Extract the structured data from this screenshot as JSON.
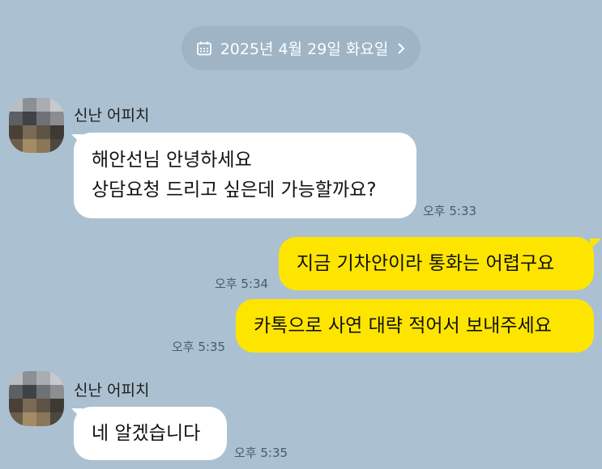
{
  "date_divider": {
    "label": "2025년 4월 29일 화요일",
    "icon": "calendar-icon",
    "chevron": "chevron-right-icon"
  },
  "colors": {
    "background": "#abc1d1",
    "incoming_bubble": "#ffffff",
    "outgoing_bubble": "#fee500",
    "date_pill": "#9fb5c6"
  },
  "messages": [
    {
      "sender": "신난 어피치",
      "lines": [
        "해안선님 안녕하세요",
        "상담요청 드리고 싶은데 가능할까요?"
      ],
      "time": "오후 5:33",
      "direction": "incoming"
    },
    {
      "lines": [
        "지금 기차안이라 통화는 어렵구요"
      ],
      "time": "오후 5:34",
      "direction": "outgoing"
    },
    {
      "lines": [
        "카톡으로 사연 대략 적어서 보내주세요"
      ],
      "time": "오후 5:35",
      "direction": "outgoing"
    },
    {
      "sender": "신난 어피치",
      "lines": [
        "네 알겠습니다"
      ],
      "time": "오후 5:35",
      "direction": "incoming"
    }
  ]
}
